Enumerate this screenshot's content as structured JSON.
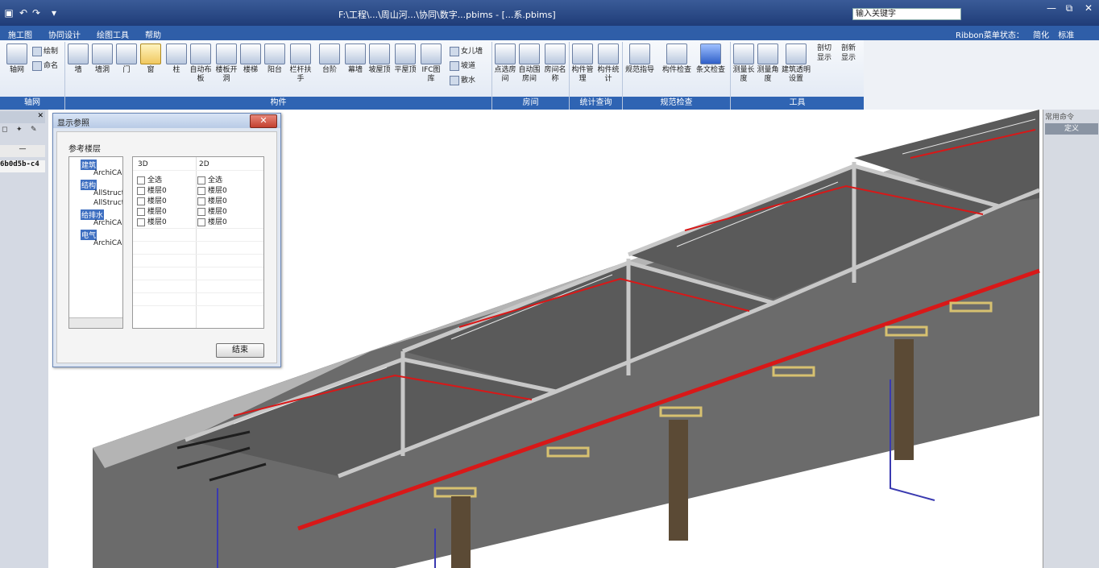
{
  "titlebar": {
    "title": "F:\\工程\\...\\周山河...\\协同\\数字...pbims - [...系.pbims]",
    "search_placeholder": "输入关键字",
    "controls": [
      "—",
      "⧉",
      "✕"
    ]
  },
  "menu": {
    "items": [
      "施工图",
      "协同设计",
      "绘图工具",
      "帮助"
    ],
    "ribbon_state_label": "Ribbon菜单状态：",
    "ribbon_state_options": [
      "简化",
      "标准"
    ]
  },
  "ribbon": {
    "groups": [
      {
        "label": "轴网",
        "tools": [
          "轴网"
        ],
        "small_tools": [
          "绘制",
          "命名"
        ]
      },
      {
        "label": "构件",
        "tools": [
          "墙",
          "墙洞",
          "门",
          "窗",
          "柱",
          "自动布板",
          "楼板开洞",
          "楼梯",
          "阳台",
          "栏杆扶手",
          "台阶",
          "幕墙",
          "坡屋顶",
          "平屋顶",
          "IFC图库"
        ],
        "small_tools": [
          "女儿墙",
          "坡道",
          "散水"
        ]
      },
      {
        "label": "房间",
        "tools": [
          "点选房间",
          "自动围房间",
          "房间名称"
        ]
      },
      {
        "label": "统计查询",
        "tools": [
          "构件管理",
          "构件统计"
        ]
      },
      {
        "label": "规范检查",
        "tools": [
          "规范指导",
          "构件检查",
          "条文检查"
        ]
      },
      {
        "label": "工具",
        "tools": [
          "测量长度",
          "测量角度",
          "建筑透明设置"
        ],
        "small_tools": [
          "剖切显示",
          "剖新显示"
        ]
      }
    ]
  },
  "leftpanel": {
    "id_text": "6b0d5b-c4"
  },
  "rightpanel": {
    "title": "常用命令",
    "item": "定义"
  },
  "dialog": {
    "title": "显示参照",
    "close": "✕",
    "heading": "参考楼层",
    "tree": [
      {
        "label": "建筑",
        "children": [
          "ArchiCAD"
        ]
      },
      {
        "label": "结构",
        "children": [
          "AllStruct",
          "AllStruct"
        ]
      },
      {
        "label": "给排水",
        "children": [
          "ArchiCAD"
        ]
      },
      {
        "label": "电气",
        "children": [
          "ArchiCAD"
        ]
      }
    ],
    "columns": [
      "3D",
      "2D"
    ],
    "rows_3d": [
      "全选",
      "楼层0",
      "楼层0",
      "楼层0",
      "楼层0"
    ],
    "rows_2d": [
      "全选",
      "楼层0",
      "楼层0",
      "楼层0",
      "楼层0"
    ],
    "button": "结束"
  }
}
